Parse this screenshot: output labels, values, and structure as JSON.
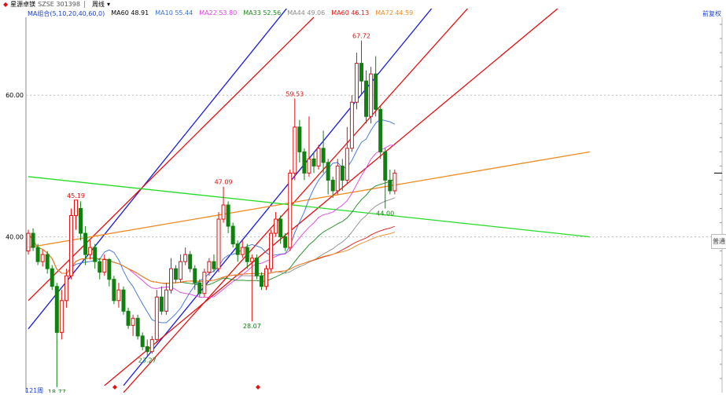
{
  "topbar": {
    "stock_name": "星源卓镁",
    "code": "SZSE 301398",
    "period": "周线",
    "dropdown_icon": "chevron-down-icon",
    "left_icon": "red-flag-icon"
  },
  "indicators": {
    "label": "MA组合(5,10,20,40,60,0)",
    "items": [
      {
        "text": "MA60 48.91",
        "color": "#000000"
      },
      {
        "text": "MA10 55.44",
        "color": "#3a6fd8"
      },
      {
        "text": "MA22 53.80",
        "color": "#e040e0"
      },
      {
        "text": "MA33 52.56",
        "color": "#1a8a1a"
      },
      {
        "text": "MA44 49.06",
        "color": "#8a8a8a"
      },
      {
        "text": "MA60 46.13",
        "color": "#e01010"
      },
      {
        "text": "MA72 44.59",
        "color": "#f08a20"
      }
    ]
  },
  "right_button": "前复权",
  "right_tab": "普通",
  "bottom_left_label": "121周",
  "chart_data": {
    "type": "candlestick",
    "ylim": [
      30,
      70
    ],
    "y_ticks": [
      40,
      60
    ],
    "annotations": [
      {
        "label": "45.19",
        "type": "high"
      },
      {
        "label": "47.09",
        "type": "high"
      },
      {
        "label": "59.53",
        "type": "high"
      },
      {
        "label": "67.72",
        "type": "high"
      },
      {
        "label": "18.77",
        "type": "low"
      },
      {
        "label": "23.27",
        "type": "low"
      },
      {
        "label": "28.07",
        "type": "low"
      },
      {
        "label": "44.00",
        "type": "low"
      }
    ],
    "candles": [
      {
        "o": 38.0,
        "c": 40.5,
        "h": 41.0,
        "l": 37.5
      },
      {
        "o": 40.5,
        "c": 38.5,
        "h": 41.2,
        "l": 38.0
      },
      {
        "o": 38.5,
        "c": 36.5,
        "h": 39.0,
        "l": 36.0
      },
      {
        "o": 36.5,
        "c": 37.5,
        "h": 38.2,
        "l": 35.8
      },
      {
        "o": 37.5,
        "c": 35.5,
        "h": 38.0,
        "l": 34.8
      },
      {
        "o": 35.5,
        "c": 33.0,
        "h": 36.0,
        "l": 32.5
      },
      {
        "o": 33.0,
        "c": 26.5,
        "h": 33.5,
        "l": 18.77
      },
      {
        "o": 26.5,
        "c": 31.0,
        "h": 32.5,
        "l": 25.5
      },
      {
        "o": 31.0,
        "c": 34.5,
        "h": 35.5,
        "l": 30.0
      },
      {
        "o": 34.5,
        "c": 43.0,
        "h": 44.0,
        "l": 34.0
      },
      {
        "o": 43.0,
        "c": 45.19,
        "h": 45.19,
        "l": 41.0
      },
      {
        "o": 44.0,
        "c": 40.5,
        "h": 45.0,
        "l": 39.5
      },
      {
        "o": 40.5,
        "c": 37.5,
        "h": 41.5,
        "l": 36.0
      },
      {
        "o": 37.5,
        "c": 38.5,
        "h": 39.5,
        "l": 36.8
      },
      {
        "o": 38.5,
        "c": 36.5,
        "h": 39.0,
        "l": 35.5
      },
      {
        "o": 36.5,
        "c": 35.0,
        "h": 37.0,
        "l": 34.0
      },
      {
        "o": 35.0,
        "c": 36.8,
        "h": 37.5,
        "l": 34.5
      },
      {
        "o": 36.8,
        "c": 34.0,
        "h": 37.0,
        "l": 33.0
      },
      {
        "o": 34.0,
        "c": 31.0,
        "h": 34.5,
        "l": 30.5
      },
      {
        "o": 31.0,
        "c": 32.5,
        "h": 33.5,
        "l": 30.0
      },
      {
        "o": 32.5,
        "c": 29.5,
        "h": 33.0,
        "l": 29.0
      },
      {
        "o": 29.5,
        "c": 27.5,
        "h": 30.0,
        "l": 27.0
      },
      {
        "o": 27.5,
        "c": 28.5,
        "h": 29.0,
        "l": 26.0
      },
      {
        "o": 28.5,
        "c": 26.0,
        "h": 29.0,
        "l": 25.5
      },
      {
        "o": 26.0,
        "c": 24.5,
        "h": 26.5,
        "l": 24.0
      },
      {
        "o": 24.5,
        "c": 23.8,
        "h": 25.5,
        "l": 23.27
      },
      {
        "o": 23.8,
        "c": 25.5,
        "h": 26.0,
        "l": 23.5
      },
      {
        "o": 25.5,
        "c": 31.5,
        "h": 32.5,
        "l": 25.0
      },
      {
        "o": 31.5,
        "c": 29.5,
        "h": 33.0,
        "l": 29.0
      },
      {
        "o": 29.5,
        "c": 32.5,
        "h": 33.5,
        "l": 29.0
      },
      {
        "o": 32.5,
        "c": 35.5,
        "h": 37.0,
        "l": 32.0
      },
      {
        "o": 35.5,
        "c": 34.0,
        "h": 36.0,
        "l": 33.5
      },
      {
        "o": 34.0,
        "c": 36.5,
        "h": 37.5,
        "l": 33.5
      },
      {
        "o": 36.5,
        "c": 37.5,
        "h": 38.5,
        "l": 36.0
      },
      {
        "o": 37.5,
        "c": 35.5,
        "h": 38.0,
        "l": 35.0
      },
      {
        "o": 35.5,
        "c": 33.5,
        "h": 36.0,
        "l": 32.5
      },
      {
        "o": 33.5,
        "c": 32.0,
        "h": 34.0,
        "l": 31.5
      },
      {
        "o": 32.0,
        "c": 35.0,
        "h": 35.5,
        "l": 31.5
      },
      {
        "o": 35.0,
        "c": 36.5,
        "h": 37.0,
        "l": 34.5
      },
      {
        "o": 36.5,
        "c": 35.5,
        "h": 37.5,
        "l": 35.0
      },
      {
        "o": 35.5,
        "c": 42.5,
        "h": 43.5,
        "l": 35.0
      },
      {
        "o": 42.5,
        "c": 44.5,
        "h": 47.09,
        "l": 42.0
      },
      {
        "o": 44.5,
        "c": 41.5,
        "h": 45.0,
        "l": 40.5
      },
      {
        "o": 41.5,
        "c": 39.0,
        "h": 42.0,
        "l": 38.5
      },
      {
        "o": 39.0,
        "c": 37.5,
        "h": 39.5,
        "l": 36.5
      },
      {
        "o": 37.5,
        "c": 38.5,
        "h": 39.5,
        "l": 37.0
      },
      {
        "o": 38.5,
        "c": 36.5,
        "h": 39.0,
        "l": 35.5
      },
      {
        "o": 36.5,
        "c": 37.0,
        "h": 37.5,
        "l": 28.07
      },
      {
        "o": 37.0,
        "c": 34.5,
        "h": 37.5,
        "l": 34.0
      },
      {
        "o": 34.5,
        "c": 33.0,
        "h": 35.0,
        "l": 32.5
      },
      {
        "o": 33.0,
        "c": 35.5,
        "h": 36.0,
        "l": 32.5
      },
      {
        "o": 35.5,
        "c": 40.5,
        "h": 41.0,
        "l": 35.0
      },
      {
        "o": 40.5,
        "c": 42.5,
        "h": 43.5,
        "l": 40.0
      },
      {
        "o": 42.5,
        "c": 40.0,
        "h": 43.0,
        "l": 39.0
      },
      {
        "o": 40.0,
        "c": 38.5,
        "h": 40.5,
        "l": 38.0
      },
      {
        "o": 38.5,
        "c": 49.0,
        "h": 49.5,
        "l": 38.0
      },
      {
        "o": 49.0,
        "c": 55.5,
        "h": 59.53,
        "l": 48.0
      },
      {
        "o": 55.5,
        "c": 52.0,
        "h": 56.5,
        "l": 50.5
      },
      {
        "o": 52.0,
        "c": 49.0,
        "h": 52.5,
        "l": 48.0
      },
      {
        "o": 49.0,
        "c": 51.0,
        "h": 57.0,
        "l": 48.5
      },
      {
        "o": 51.0,
        "c": 50.0,
        "h": 52.0,
        "l": 49.0
      },
      {
        "o": 50.0,
        "c": 52.5,
        "h": 53.0,
        "l": 49.5
      },
      {
        "o": 52.5,
        "c": 50.5,
        "h": 55.0,
        "l": 49.0
      },
      {
        "o": 50.5,
        "c": 48.0,
        "h": 51.0,
        "l": 46.0
      },
      {
        "o": 48.0,
        "c": 46.5,
        "h": 48.5,
        "l": 45.5
      },
      {
        "o": 46.5,
        "c": 50.0,
        "h": 51.0,
        "l": 46.0
      },
      {
        "o": 50.0,
        "c": 48.0,
        "h": 51.0,
        "l": 46.5
      },
      {
        "o": 48.0,
        "c": 52.5,
        "h": 55.5,
        "l": 47.5
      },
      {
        "o": 52.5,
        "c": 59.0,
        "h": 60.0,
        "l": 52.0
      },
      {
        "o": 59.0,
        "c": 64.5,
        "h": 66.0,
        "l": 58.0
      },
      {
        "o": 64.5,
        "c": 62.0,
        "h": 67.72,
        "l": 60.0
      },
      {
        "o": 62.0,
        "c": 57.0,
        "h": 63.5,
        "l": 56.0
      },
      {
        "o": 57.0,
        "c": 63.0,
        "h": 64.0,
        "l": 56.0
      },
      {
        "o": 63.0,
        "c": 58.0,
        "h": 65.5,
        "l": 57.0
      },
      {
        "o": 58.0,
        "c": 52.0,
        "h": 58.5,
        "l": 51.0
      },
      {
        "o": 52.0,
        "c": 48.0,
        "h": 52.5,
        "l": 44.0
      },
      {
        "o": 48.0,
        "c": 46.5,
        "h": 49.5,
        "l": 46.0
      },
      {
        "o": 46.5,
        "c": 49.0,
        "h": 49.5,
        "l": 46.0
      }
    ],
    "moving_averages": [
      {
        "name": "MA10",
        "color": "#3a6fd8"
      },
      {
        "name": "MA22",
        "color": "#e040e0"
      },
      {
        "name": "MA33",
        "color": "#1a8a1a"
      },
      {
        "name": "MA44",
        "color": "#8a8a8a"
      },
      {
        "name": "MA60",
        "color": "#e01010"
      },
      {
        "name": "MA72",
        "color": "#f08a20"
      }
    ],
    "trend_lines": [
      {
        "color": "#1a1ad8",
        "p1": {
          "i": 0,
          "v": 27
        },
        "p2": {
          "i": 60,
          "v": 77
        }
      },
      {
        "color": "#1a1ad8",
        "p1": {
          "i": 20,
          "v": 19
        },
        "p2": {
          "i": 110,
          "v": 93
        }
      },
      {
        "color": "#e01010",
        "p1": {
          "i": 0,
          "v": 31
        },
        "p2": {
          "i": 60,
          "v": 71
        }
      },
      {
        "color": "#e01010",
        "p1": {
          "i": 16,
          "v": 19
        },
        "p2": {
          "i": 118,
          "v": 76
        }
      },
      {
        "color": "#e01010",
        "p1": {
          "i": 20,
          "v": 18
        },
        "p2": {
          "i": 112,
          "v": 87
        }
      },
      {
        "color": "#f08a20",
        "p1": {
          "i": 0,
          "v": 38.5
        },
        "p2": {
          "i": 118,
          "v": 52
        }
      },
      {
        "color": "#22dd22",
        "p1": {
          "i": 0,
          "v": 48.5
        },
        "p2": {
          "i": 118,
          "v": 40
        }
      }
    ]
  }
}
